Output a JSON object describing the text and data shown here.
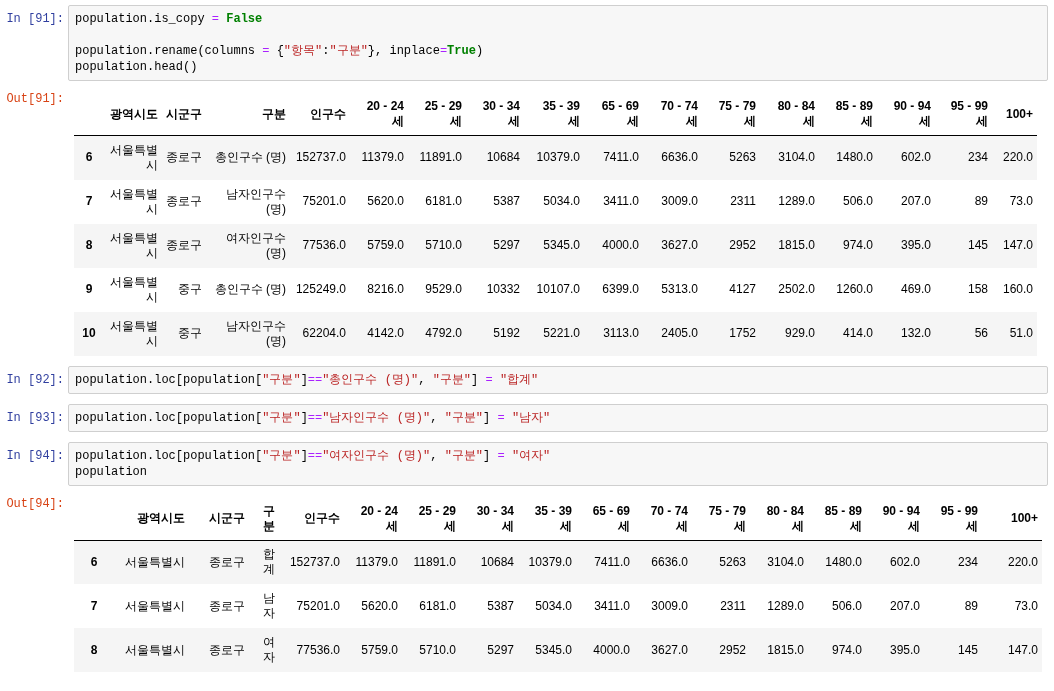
{
  "cells": [
    {
      "kind": "input",
      "prompt": "In [91]:",
      "lines": [
        {
          "kind": "code",
          "tokens": [
            {
              "t": "population.is_copy ",
              "kind": "plain"
            },
            {
              "t": "=",
              "kind": "op"
            },
            {
              "t": " False",
              "kind": "kw"
            }
          ]
        },
        {
          "kind": "blank"
        },
        {
          "kind": "code",
          "tokens": [
            {
              "t": "population.rename(columns ",
              "kind": "plain"
            },
            {
              "t": "=",
              "kind": "op"
            },
            {
              "t": " {",
              "kind": "plain"
            },
            {
              "t": "\"항목\"",
              "kind": "str"
            },
            {
              "t": ":",
              "kind": "plain"
            },
            {
              "t": "\"구분\"",
              "kind": "str"
            },
            {
              "t": "}, inplace",
              "kind": "plain"
            },
            {
              "t": "=",
              "kind": "op"
            },
            {
              "t": "True",
              "kind": "kw"
            },
            {
              "t": ")",
              "kind": "plain"
            }
          ]
        },
        {
          "kind": "code",
          "tokens": [
            {
              "t": "population.head()",
              "kind": "plain"
            }
          ]
        }
      ]
    },
    {
      "kind": "output",
      "prompt": "Out[91]:",
      "columns": [
        "광역시도",
        "시군구",
        "구분",
        "인구수",
        "20 - 24 세",
        "25 - 29 세",
        "30 - 34 세",
        "35 - 39 세",
        "65 - 69 세",
        "70 - 74 세",
        "75 - 79 세",
        "80 - 84 세",
        "85 - 89 세",
        "90 - 94 세",
        "95 - 99 세",
        "100+"
      ],
      "rows": [
        {
          "index": "6",
          "cells": [
            "서울특별시",
            "종로구",
            "총인구수 (명)",
            "152737.0",
            "11379.0",
            "11891.0",
            "10684",
            "10379.0",
            "7411.0",
            "6636.0",
            "5263",
            "3104.0",
            "1480.0",
            "602.0",
            "234",
            "220.0"
          ]
        },
        {
          "index": "7",
          "cells": [
            "서울특별시",
            "종로구",
            "남자인구수 (명)",
            "75201.0",
            "5620.0",
            "6181.0",
            "5387",
            "5034.0",
            "3411.0",
            "3009.0",
            "2311",
            "1289.0",
            "506.0",
            "207.0",
            "89",
            "73.0"
          ]
        },
        {
          "index": "8",
          "cells": [
            "서울특별시",
            "종로구",
            "여자인구수 (명)",
            "77536.0",
            "5759.0",
            "5710.0",
            "5297",
            "5345.0",
            "4000.0",
            "3627.0",
            "2952",
            "1815.0",
            "974.0",
            "395.0",
            "145",
            "147.0"
          ]
        },
        {
          "index": "9",
          "cells": [
            "서울특별시",
            "중구",
            "총인구수 (명)",
            "125249.0",
            "8216.0",
            "9529.0",
            "10332",
            "10107.0",
            "6399.0",
            "5313.0",
            "4127",
            "2502.0",
            "1260.0",
            "469.0",
            "158",
            "160.0"
          ]
        },
        {
          "index": "10",
          "cells": [
            "서울특별시",
            "중구",
            "남자인구수 (명)",
            "62204.0",
            "4142.0",
            "4792.0",
            "5192",
            "5221.0",
            "3113.0",
            "2405.0",
            "1752",
            "929.0",
            "414.0",
            "132.0",
            "56",
            "51.0"
          ]
        }
      ]
    },
    {
      "kind": "input",
      "prompt": "In [92]:",
      "lines": [
        {
          "kind": "code",
          "tokens": [
            {
              "t": "population.loc[population[",
              "kind": "plain"
            },
            {
              "t": "\"구분\"",
              "kind": "str"
            },
            {
              "t": "]",
              "kind": "plain"
            },
            {
              "t": "==",
              "kind": "op"
            },
            {
              "t": "\"총인구수 (명)\"",
              "kind": "str"
            },
            {
              "t": ", ",
              "kind": "plain"
            },
            {
              "t": "\"구분\"",
              "kind": "str"
            },
            {
              "t": "] ",
              "kind": "plain"
            },
            {
              "t": "=",
              "kind": "op"
            },
            {
              "t": " \"합계\"",
              "kind": "str"
            }
          ]
        }
      ]
    },
    {
      "kind": "input",
      "prompt": "In [93]:",
      "lines": [
        {
          "kind": "code",
          "tokens": [
            {
              "t": "population.loc[population[",
              "kind": "plain"
            },
            {
              "t": "\"구분\"",
              "kind": "str"
            },
            {
              "t": "]",
              "kind": "plain"
            },
            {
              "t": "==",
              "kind": "op"
            },
            {
              "t": "\"남자인구수 (명)\"",
              "kind": "str"
            },
            {
              "t": ", ",
              "kind": "plain"
            },
            {
              "t": "\"구분\"",
              "kind": "str"
            },
            {
              "t": "] ",
              "kind": "plain"
            },
            {
              "t": "=",
              "kind": "op"
            },
            {
              "t": " \"남자\"",
              "kind": "str"
            }
          ]
        }
      ]
    },
    {
      "kind": "input",
      "prompt": "In [94]:",
      "lines": [
        {
          "kind": "code",
          "tokens": [
            {
              "t": "population.loc[population[",
              "kind": "plain"
            },
            {
              "t": "\"구분\"",
              "kind": "str"
            },
            {
              "t": "]",
              "kind": "plain"
            },
            {
              "t": "==",
              "kind": "op"
            },
            {
              "t": "\"여자인구수 (명)\"",
              "kind": "str"
            },
            {
              "t": ", ",
              "kind": "plain"
            },
            {
              "t": "\"구분\"",
              "kind": "str"
            },
            {
              "t": "] ",
              "kind": "plain"
            },
            {
              "t": "=",
              "kind": "op"
            },
            {
              "t": " \"여자\"",
              "kind": "str"
            }
          ]
        },
        {
          "kind": "code",
          "tokens": [
            {
              "t": "population",
              "kind": "plain"
            }
          ]
        }
      ]
    },
    {
      "kind": "output",
      "prompt": "Out[94]:",
      "columns": [
        "광역시도",
        "시군구",
        "구분",
        "인구수",
        "20 - 24 세",
        "25 - 29 세",
        "30 - 34 세",
        "35 - 39 세",
        "65 - 69 세",
        "70 - 74 세",
        "75 - 79 세",
        "80 - 84 세",
        "85 - 89 세",
        "90 - 94 세",
        "95 - 99 세",
        "100+"
      ],
      "rows": [
        {
          "index": "6",
          "cells": [
            "서울특별시",
            "종로구",
            "합계",
            "152737.0",
            "11379.0",
            "11891.0",
            "10684",
            "10379.0",
            "7411.0",
            "6636.0",
            "5263",
            "3104.0",
            "1480.0",
            "602.0",
            "234",
            "220.0"
          ]
        },
        {
          "index": "7",
          "cells": [
            "서울특별시",
            "종로구",
            "남자",
            "75201.0",
            "5620.0",
            "6181.0",
            "5387",
            "5034.0",
            "3411.0",
            "3009.0",
            "2311",
            "1289.0",
            "506.0",
            "207.0",
            "89",
            "73.0"
          ]
        },
        {
          "index": "8",
          "cells": [
            "서울특별시",
            "종로구",
            "여자",
            "77536.0",
            "5759.0",
            "5710.0",
            "5297",
            "5345.0",
            "4000.0",
            "3627.0",
            "2952",
            "1815.0",
            "974.0",
            "395.0",
            "145",
            "147.0"
          ]
        }
      ]
    }
  ]
}
